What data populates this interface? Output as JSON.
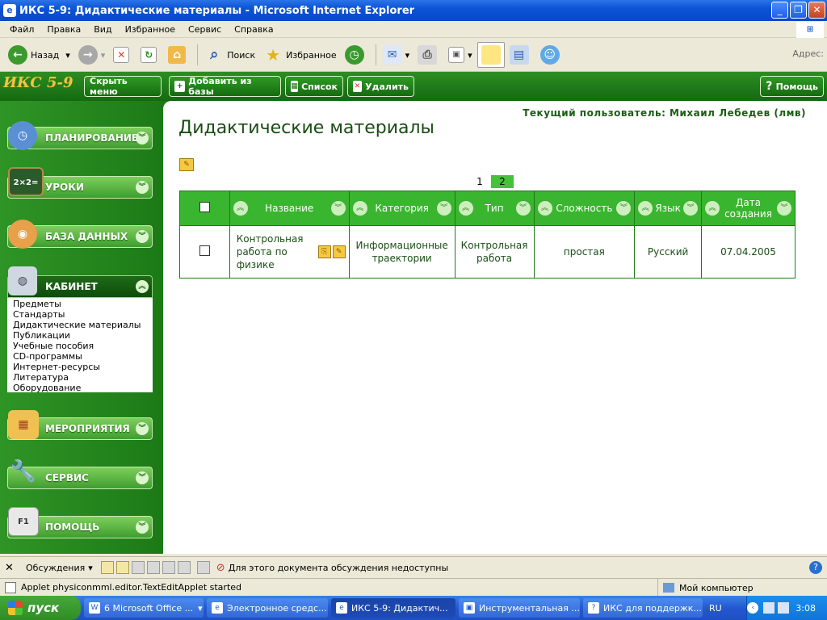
{
  "window": {
    "title": "ИКС 5-9: Дидактические материалы - Microsoft Internet Explorer"
  },
  "menu": [
    "Файл",
    "Правка",
    "Вид",
    "Избранное",
    "Сервис",
    "Справка"
  ],
  "toolbar": {
    "back": "Назад",
    "search": "Поиск",
    "favorites": "Избранное",
    "address_label": "Адрес:"
  },
  "app": {
    "logo": "ИКС 5-9",
    "buttons": {
      "hide_menu": "Скрыть меню",
      "add_from_db": "Добавить из базы",
      "list": "Список",
      "delete": "Удалить",
      "help": "Помощь"
    },
    "sidebar": {
      "planning": "ПЛАНИРОВАНИЕ",
      "lessons": "УРОКИ",
      "database": "БАЗА ДАННЫХ",
      "cabinet": "КАБИНЕТ",
      "cabinet_items": [
        "Предметы",
        "Стандарты",
        "Дидактические материалы",
        "Публикации",
        "Учебные пособия",
        "CD-программы",
        "Интернет-ресурсы",
        "Литература",
        "Оборудование"
      ],
      "events": "МЕРОПРИЯТИЯ",
      "service": "СЕРВИС",
      "help": "ПОМОЩЬ"
    },
    "current_user": "Текущий пользователь: Михаил Лебедев (лмв)",
    "page_title": "Дидактические материалы",
    "pager": {
      "p1": "1",
      "p2": "2"
    },
    "table": {
      "headers": {
        "name": "Название",
        "category": "Категория",
        "type": "Тип",
        "difficulty": "Сложность",
        "language": "Язык",
        "date": "Дата создания"
      },
      "row": {
        "name": "Контрольная работа по физике",
        "category": "Информационные траектории",
        "type": "Контрольная работа",
        "difficulty": "простая",
        "language": "Русский",
        "date": "07.04.2005"
      }
    }
  },
  "discussions": {
    "label": "Обсуждения",
    "status": "Для этого документа обсуждения недоступны"
  },
  "status": {
    "text": "Applet physiconmml.editor.TextEditApplet started",
    "zone": "Мой компьютер"
  },
  "taskbar": {
    "start": "пуск",
    "tasks": [
      "6 Microsoft Office ...",
      "Электронное средс...",
      "ИКС 5-9: Дидактич...",
      "Инструментальная ...",
      "ИКС для поддержк..."
    ],
    "lang": "RU",
    "clock": "3:08"
  }
}
